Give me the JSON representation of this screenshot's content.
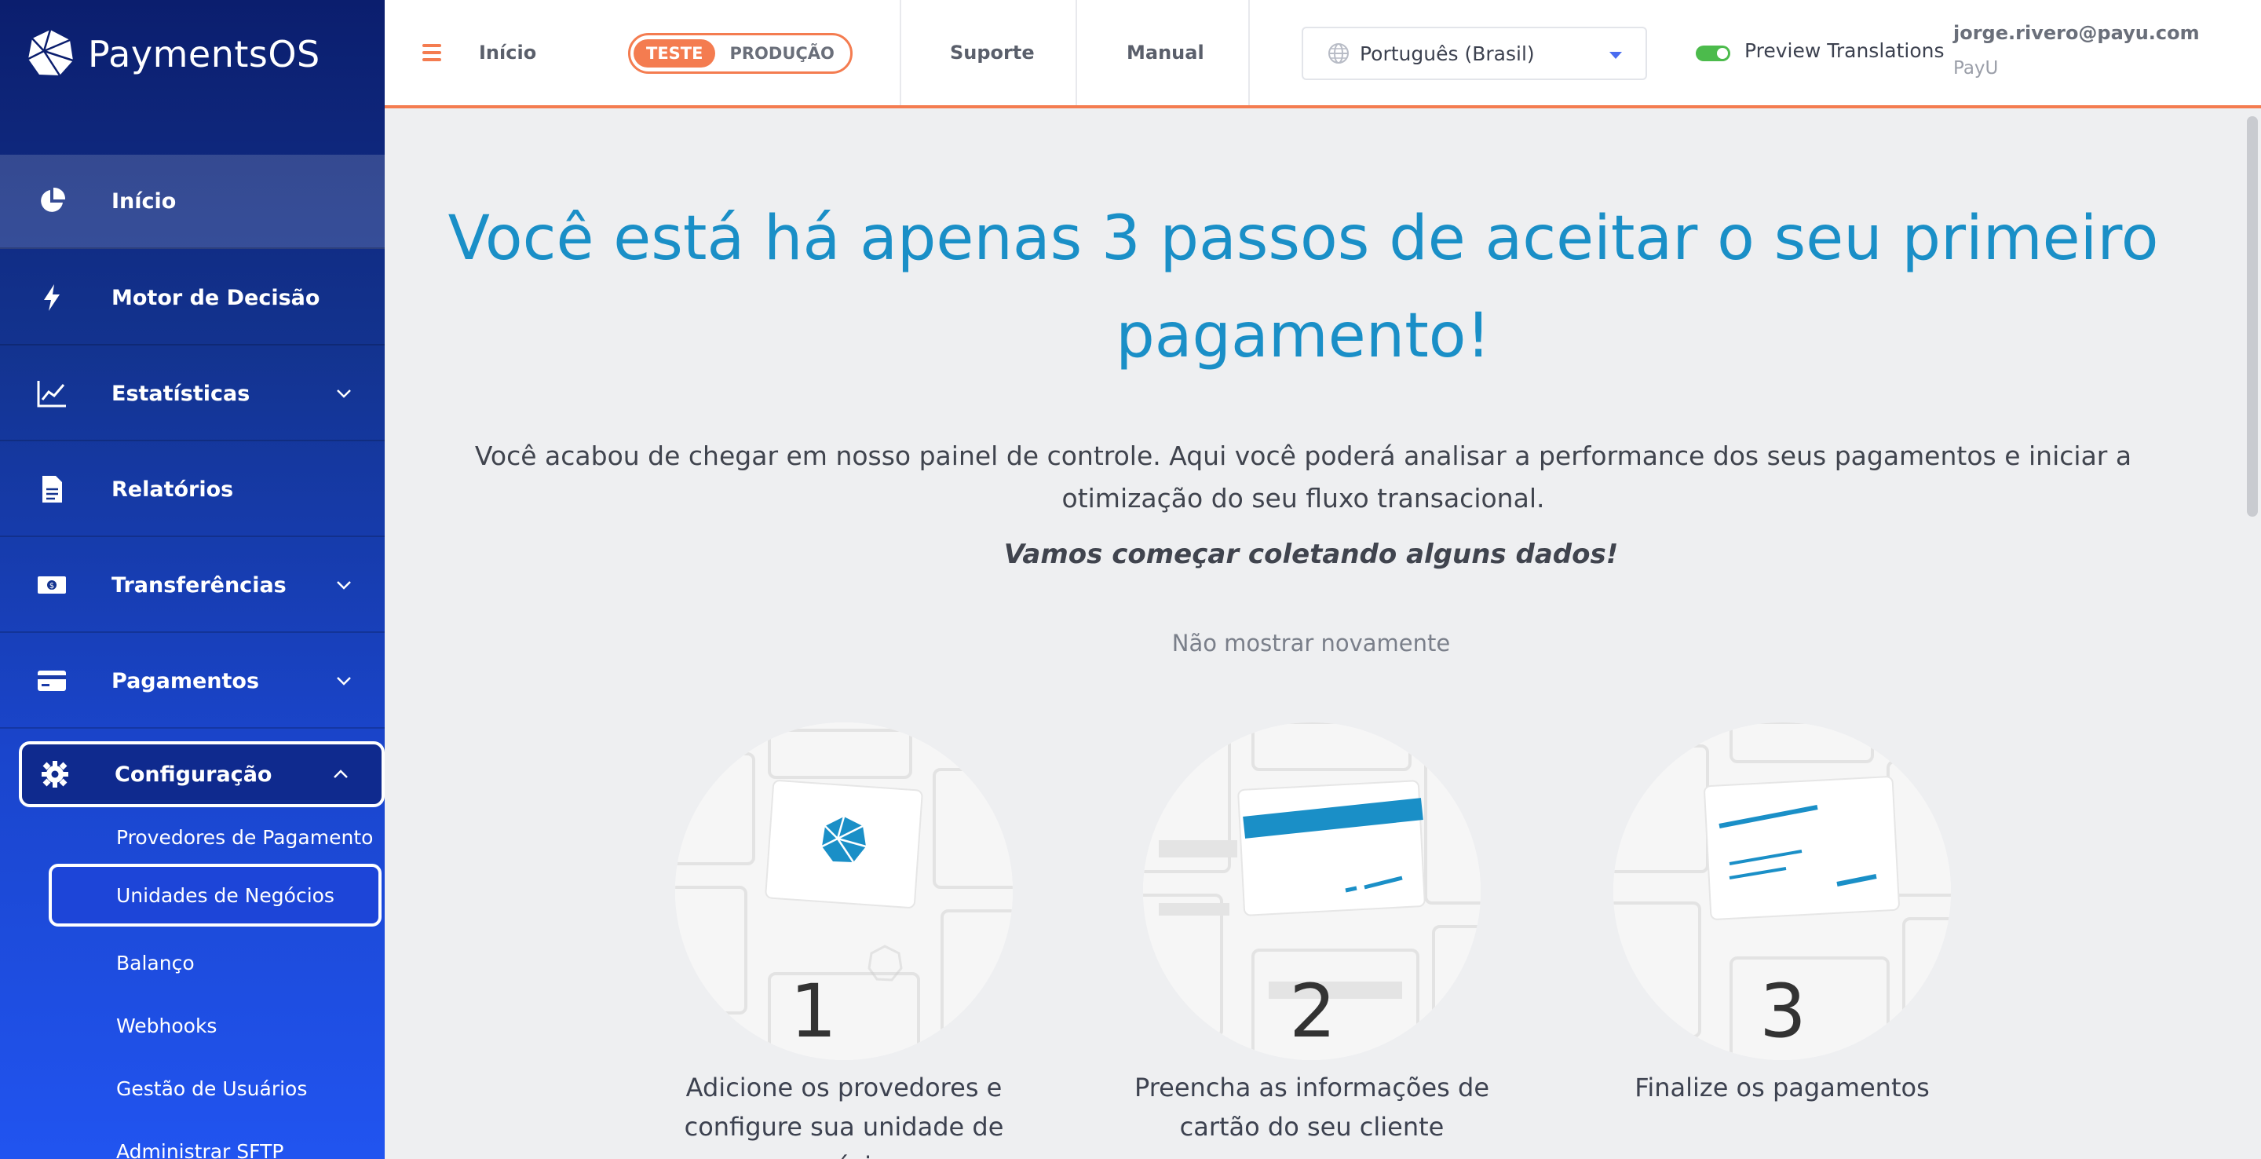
{
  "brand": {
    "name": "PaymentsOS"
  },
  "sidebar": {
    "items": [
      {
        "label": "Início",
        "icon": "pie-chart-icon"
      },
      {
        "label": "Motor de Decisão",
        "icon": "bolt-icon"
      },
      {
        "label": "Estatísticas",
        "icon": "line-chart-icon"
      },
      {
        "label": "Relatórios",
        "icon": "document-icon"
      },
      {
        "label": "Transferências",
        "icon": "money-icon"
      },
      {
        "label": "Pagamentos",
        "icon": "credit-card-icon"
      },
      {
        "label": "Configuração",
        "icon": "gear-icon"
      }
    ],
    "sub_items": [
      "Provedores de Pagamento",
      "Unidades de Negócios",
      "Balanço",
      "Webhooks",
      "Gestão de Usuários",
      "Administrar SFTP"
    ]
  },
  "header": {
    "home_link": "Início",
    "env_test": "TESTE",
    "env_prod": "PRODUÇÃO",
    "support": "Suporte",
    "manual": "Manual",
    "language": "Português (Brasil)",
    "preview_translations": "Preview Translations",
    "user_email": "jorge.rivero@payu.com",
    "user_org": "PayU"
  },
  "main": {
    "headline": "Você está há apenas 3 passos de aceitar o seu primeiro pagamento!",
    "intro": "Você acabou de chegar em nosso painel de controle. Aqui você poderá analisar a performance dos seus pagamentos e iniciar a otimização do seu fluxo transacional.",
    "cta": "Vamos começar coletando alguns dados!",
    "dismiss": "Não mostrar novamente",
    "steps": [
      {
        "number": "1",
        "caption": "Adicione os provedores e configure sua unidade de negócios"
      },
      {
        "number": "2",
        "caption": "Preencha as informações de cartão do seu cliente"
      },
      {
        "number": "3",
        "caption": "Finalize os pagamentos"
      }
    ]
  },
  "colors": {
    "accent": "#f47c50",
    "headline": "#1a8fc7",
    "sidebar_top": "#0b1e6e",
    "sidebar_bottom": "#2154f0"
  }
}
